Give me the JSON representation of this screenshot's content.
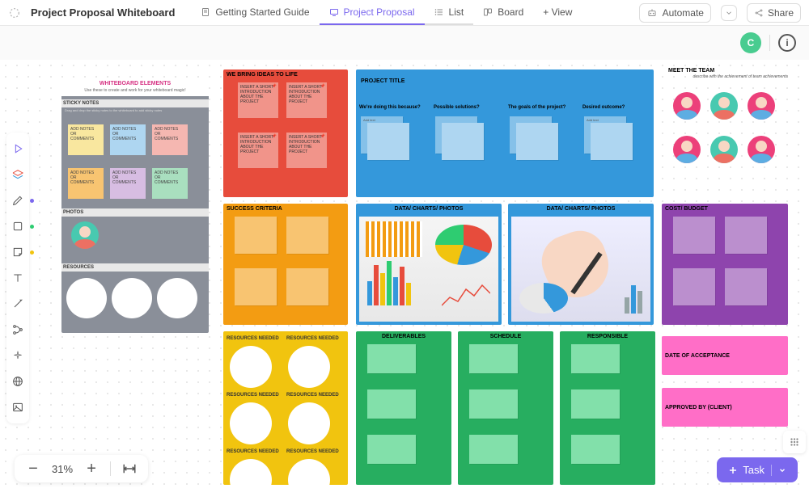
{
  "header": {
    "page_title": "Project Proposal Whiteboard",
    "tabs": [
      {
        "label": "Getting Started Guide",
        "active": false
      },
      {
        "label": "Project Proposal",
        "active": true
      },
      {
        "label": "List",
        "active": false
      },
      {
        "label": "Board",
        "active": false
      },
      {
        "label": "+ View",
        "active": false
      }
    ],
    "automate": "Automate",
    "share": "Share",
    "avatar_letter": "C"
  },
  "zoom": {
    "percent": "31%"
  },
  "task_button": "Task",
  "whiteboard_elements": {
    "title": "WHITEBOARD ELEMENTS",
    "subtitle": "Use these to create and work for your whiteboard magic!",
    "sticky_notes_label": "STICKY NOTES",
    "sticky_instr": "Drag and drop the sticky notes to the whiteboard to add sticky notes",
    "sticky_text": "ADD NOTES OR COMMENTS",
    "photos_label": "PHOTOS",
    "resources_label": "RESOURCES"
  },
  "ideas": {
    "title": "WE BRING IDEAS TO LIFE",
    "sticky_text": "INSERT A SHORT INTRODUCTION ABOUT THE PROJECT"
  },
  "project": {
    "title": "PROJECT TITLE",
    "cols": [
      "We're doing this because?",
      "Possible solutions?",
      "The goals of the project?",
      "Desired outcome?"
    ],
    "sticky_placeholder": "Add text"
  },
  "success": {
    "title": "SUCCESS CRITERIA"
  },
  "data1": {
    "title": "DATA/ CHARTS/ PHOTOS"
  },
  "data2": {
    "title": "DATA/ CHARTS/ PHOTOS"
  },
  "team": {
    "title": "MEET THE TEAM",
    "subtitle": "describe with the achievement of team achievements"
  },
  "cost": {
    "title": "COST/ BUDGET"
  },
  "resources_needed": {
    "label": "RESOURCES NEEDED"
  },
  "deliverables": {
    "title": "DELIVERABLES"
  },
  "schedule": {
    "title": "SCHEDULE"
  },
  "responsible": {
    "title": "RESPONSIBLE"
  },
  "acceptance": {
    "title": "DATE OF ACCEPTANCE"
  },
  "approved": {
    "title": "APPROVED BY (CLIENT)"
  }
}
